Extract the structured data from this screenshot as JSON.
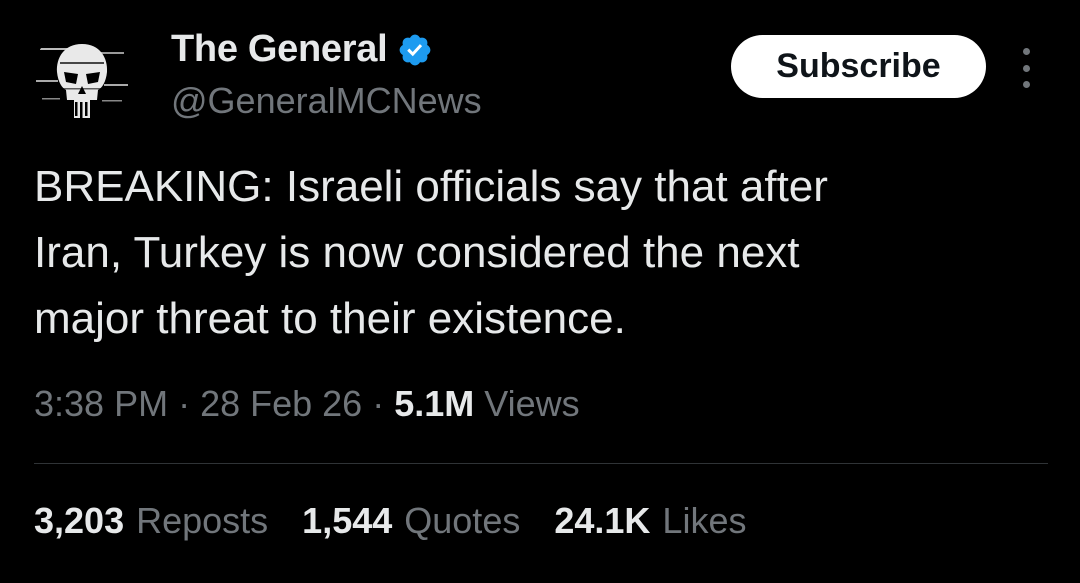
{
  "author": {
    "display_name": "The General",
    "handle": "@GeneralMCNews",
    "verified": true,
    "verified_color": "#1d9bf0"
  },
  "actions": {
    "subscribe_label": "Subscribe",
    "more_icon": "more-vertical-icon"
  },
  "tweet": {
    "text": "BREAKING: Israeli officials say that after\nIran, Turkey is now considered the next\nmajor threat to their existence."
  },
  "meta": {
    "time": "3:38 PM",
    "separator": "·",
    "date": "28 Feb 26",
    "views_count": "5.1M",
    "views_label": "Views"
  },
  "stats": {
    "reposts": {
      "count": "3,203",
      "label": "Reposts"
    },
    "quotes": {
      "count": "1,544",
      "label": "Quotes"
    },
    "likes": {
      "count": "24.1K",
      "label": "Likes"
    }
  },
  "colors": {
    "background": "#000000",
    "text_primary": "#e7e9ea",
    "text_secondary": "#71767b",
    "button_bg": "#ffffff",
    "button_text": "#0f1419",
    "divider": "#2f3336"
  }
}
